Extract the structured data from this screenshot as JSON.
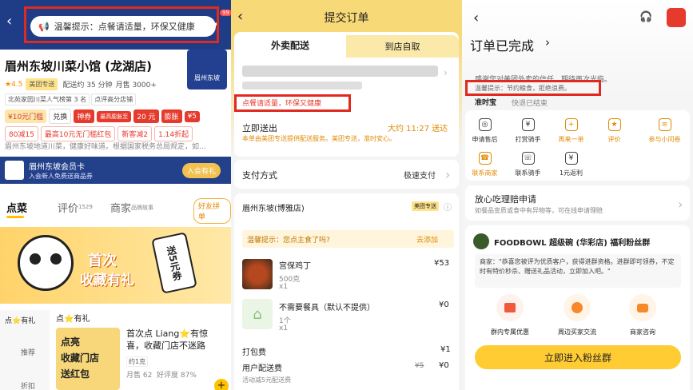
{
  "panel1": {
    "notice_text": "温馨提示：点餐请适量，环保又健康",
    "badge_count": "99",
    "store_name": "眉州东坡川菜小馆 (龙湖店)",
    "rating": "★4.5",
    "rating_tag": "美团专送",
    "delivery_time": "配送约 35 分钟",
    "monthly_sales": "月售 3000+",
    "logo_text": "眉州东坡",
    "logo_sub": "川菜小馆",
    "tags": [
      "北苑家园川菜人气榜第 3 名",
      "点评高分店铺"
    ],
    "coupon_main": "¥10元门槛",
    "coupon_exchange": "兑换",
    "coupon_special": "神券",
    "coupon_max": "最高膨胀至",
    "coupon_amount": "20 元",
    "coupon_expand": "膨胀",
    "coupon_five": "¥5",
    "promos": [
      "80减15",
      "最高10元无门槛红包",
      "新客减2",
      "1.14折起"
    ],
    "intro": "眉州东坡地道川菜，健康好味道。根据国家税务总局规定，如…",
    "member_title": "眉州东坡会员卡",
    "member_desc": "入会新人免费送商品券",
    "member_btn": "入会有礼",
    "tabs": [
      "点菜",
      "评价",
      "商家"
    ],
    "review_count": "1529",
    "merchant_sub": "品牌故事",
    "friend_btn": "好友拼单",
    "banner_line1": "首次",
    "banner_line2": "收藏有礼",
    "banner_badge": "送5元券",
    "side_cats": [
      "点⭐有礼",
      "推荐",
      "折扣"
    ],
    "section_title": "点⭐有礼",
    "gift_card_lines": [
      "点亮",
      "收藏门店",
      "送红包"
    ],
    "gift_item_title": "首次点 Liang⭐有惊喜，收藏门店不迷路",
    "gift_item_qty": "约1克",
    "gift_item_sales": "月售 62",
    "gift_item_rate": "好评度 87%"
  },
  "panel2": {
    "title": "提交订单",
    "tab_delivery": "外卖配送",
    "tab_pickup": "到店自取",
    "notice": "点餐请适量，环保又健康",
    "deliver_now": "立即送出",
    "eta": "大约 11:27 送达",
    "eta_sub": "本单由美团专送提供配送服务。美团专送，准时安心。",
    "payment_label": "支付方式",
    "payment_value": "极速支付",
    "store": "眉州东坡(博雅店)",
    "store_tag": "美团专送",
    "tip_text": "温馨提示：您点主食了吗?",
    "tip_action": "去添加",
    "items": [
      {
        "name": "宫保鸡丁",
        "spec": "500克",
        "qty": "x1",
        "price": "¥53"
      },
      {
        "name": "不需要餐具（默认不提供）",
        "spec": "1个",
        "qty": "x1",
        "price": "¥0"
      }
    ],
    "packing_label": "打包费",
    "packing_price": "¥1",
    "delivery_label": "用户配送费",
    "delivery_old": "¥5",
    "delivery_price": "¥0",
    "delivery_note": "活动减5元配送费"
  },
  "panel3": {
    "title": "订单已完成",
    "thanks": "感谢您对美团外卖的信任，期待再次光临。",
    "tip": "温馨提示：节约粮食，拒绝浪费。",
    "ontime": "准时宝",
    "ontime_sub": "快退已结束",
    "actions_row1": [
      "申请售后",
      "打赏骑手",
      "再来一单",
      "评价",
      "参与小问卷"
    ],
    "actions_row2": [
      "联系商家",
      "联系骑手",
      "1元返利"
    ],
    "claim_title": "放心吃理赔申请",
    "claim_desc": "如餐品变质或食中有异物等，可在线申请理赔",
    "fan_title": "FOODBOWL 超级碗 (华彩店) 福利粉丝群",
    "fan_desc": "商家：\"恭喜您被评为优质客户，获得进群资格。进群即可领券，不定时有特价秒杀、赠送礼品活动，立即加入吧。\"",
    "fan_icons": [
      "群内专属优惠",
      "周边买家交流",
      "商家咨询"
    ],
    "join_btn": "立即进入粉丝群"
  }
}
